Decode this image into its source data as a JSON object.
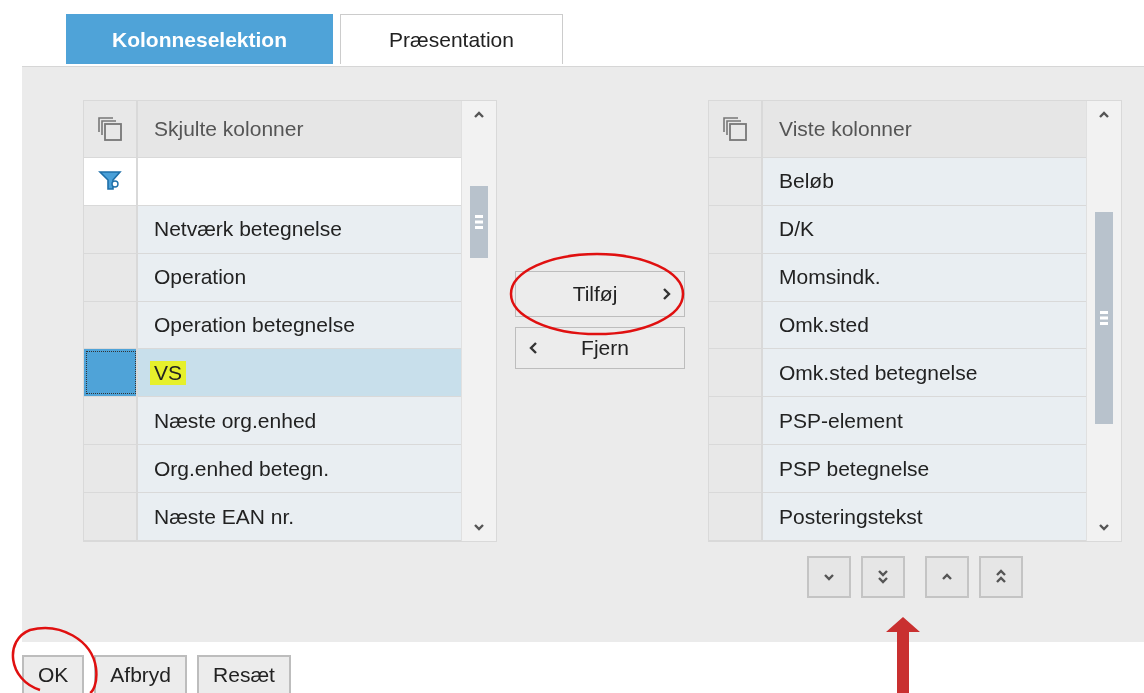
{
  "tabs": [
    {
      "label": "Kolonneselektion",
      "selected": true
    },
    {
      "label": "Præsentation",
      "selected": false
    }
  ],
  "hidden_columns": {
    "header": "Skjulte kolonner",
    "filter": true,
    "rows": [
      {
        "label": "Netværk betegnelse",
        "selected": false,
        "highlighted": false
      },
      {
        "label": "Operation",
        "selected": false,
        "highlighted": false
      },
      {
        "label": "Operation betegnelse",
        "selected": false,
        "highlighted": false
      },
      {
        "label": "VS",
        "selected": true,
        "highlighted": true
      },
      {
        "label": "Næste org.enhed",
        "selected": false,
        "highlighted": false
      },
      {
        "label": "Org.enhed betegn.",
        "selected": false,
        "highlighted": false
      },
      {
        "label": "Næste EAN nr.",
        "selected": false,
        "highlighted": false
      }
    ]
  },
  "add_button": {
    "label": "Tilføj"
  },
  "remove_button": {
    "label": "Fjern"
  },
  "shown_columns": {
    "header": "Viste kolonner",
    "filter": false,
    "rows": [
      {
        "label": "Beløb",
        "selected": false,
        "highlighted": false
      },
      {
        "label": "D/K",
        "selected": false,
        "highlighted": false
      },
      {
        "label": "Momsindk.",
        "selected": false,
        "highlighted": false
      },
      {
        "label": "Omk.sted",
        "selected": false,
        "highlighted": false
      },
      {
        "label": "Omk.sted betegnelse",
        "selected": false,
        "highlighted": false
      },
      {
        "label": "PSP-element",
        "selected": false,
        "highlighted": false
      },
      {
        "label": "PSP betegnelse",
        "selected": false,
        "highlighted": false
      },
      {
        "label": "Posteringstekst",
        "selected": false,
        "highlighted": false
      }
    ]
  },
  "buttons": [
    "OK",
    "Afbryd",
    "Resæt"
  ]
}
